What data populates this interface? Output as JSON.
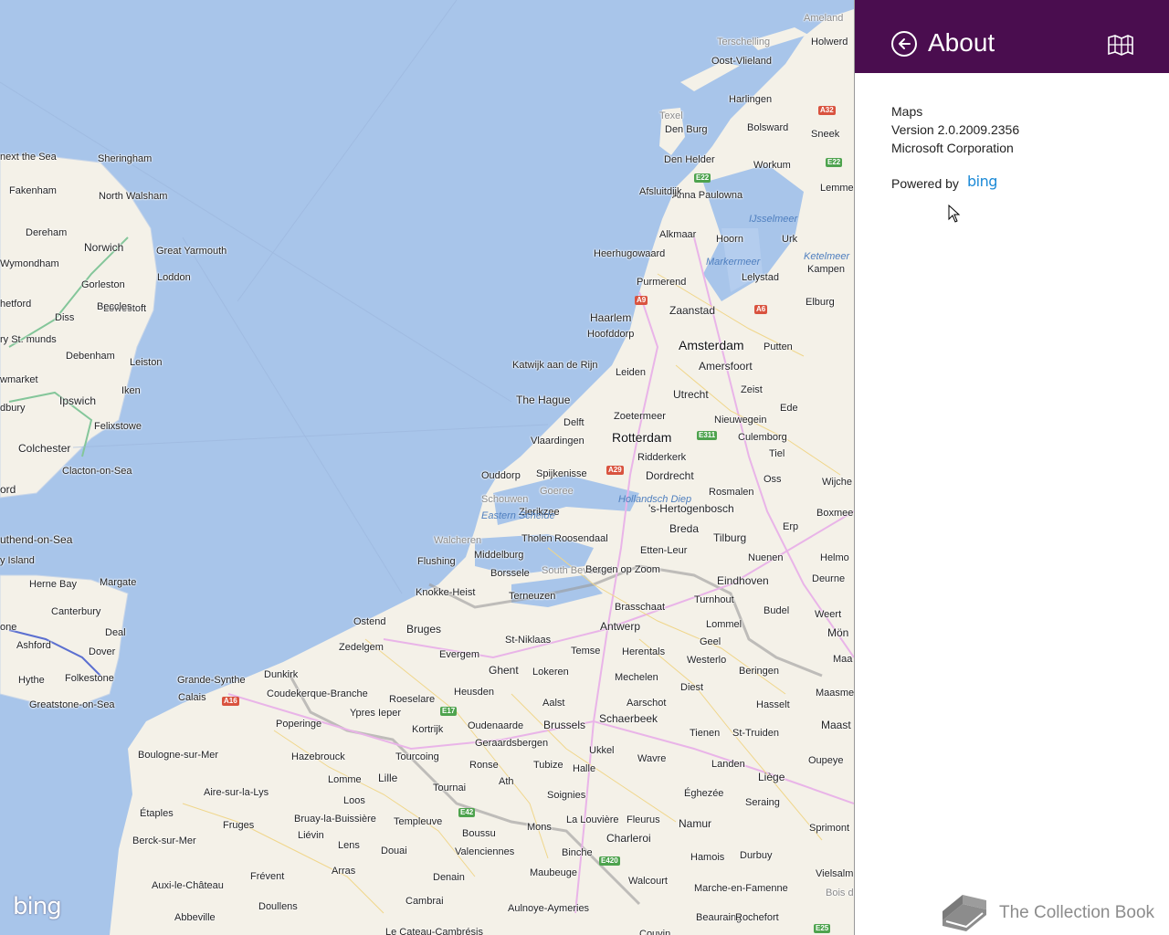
{
  "about_pane": {
    "title": "About",
    "app_name": "Maps",
    "version": "Version 2.0.2009.2356",
    "publisher": "Microsoft Corporation",
    "powered_by_label": "Powered by",
    "provider_logo_text": "bing",
    "header_color": "#4a0d4f",
    "back_icon": "back-arrow-circle-icon",
    "app_icon": "maps-tile-icon"
  },
  "map": {
    "watermark_text": "bing",
    "water_color": "#a8c5ea",
    "land_color": "#f4f1e8",
    "labels": [
      {
        "text": "Ameland",
        "cls": "faint"
      },
      {
        "text": "Terschelling",
        "cls": "faint"
      },
      {
        "text": "Holwerd",
        "cls": ""
      },
      {
        "text": "Oost-Vlieland",
        "cls": ""
      },
      {
        "text": "Harlingen",
        "cls": ""
      },
      {
        "text": "Texel",
        "cls": "faint"
      },
      {
        "text": "Den Burg",
        "cls": ""
      },
      {
        "text": "Bolsward",
        "cls": ""
      },
      {
        "text": "Sneek",
        "cls": ""
      },
      {
        "text": "Den Helder",
        "cls": ""
      },
      {
        "text": "Workum",
        "cls": ""
      },
      {
        "text": "Anna Paulowna",
        "cls": ""
      },
      {
        "text": "Lemme",
        "cls": ""
      },
      {
        "text": "Afsluitdijk",
        "cls": ""
      },
      {
        "text": "IJsselmeer",
        "cls": "water"
      },
      {
        "text": "Alkmaar",
        "cls": ""
      },
      {
        "text": "Hoorn",
        "cls": ""
      },
      {
        "text": "Urk",
        "cls": ""
      },
      {
        "text": "Ketelmeer",
        "cls": "water"
      },
      {
        "text": "Heerhugowaard",
        "cls": ""
      },
      {
        "text": "Markermeer",
        "cls": "water"
      },
      {
        "text": "Kampen",
        "cls": ""
      },
      {
        "text": "Lelystad",
        "cls": ""
      },
      {
        "text": "Purmerend",
        "cls": ""
      },
      {
        "text": "Elburg",
        "cls": ""
      },
      {
        "text": "Zaanstad",
        "cls": "mid"
      },
      {
        "text": "Haarlem",
        "cls": "mid"
      },
      {
        "text": "Hoofddorp",
        "cls": ""
      },
      {
        "text": "Amsterdam",
        "cls": "big"
      },
      {
        "text": "Putten",
        "cls": ""
      },
      {
        "text": "Katwijk aan de Rijn",
        "cls": ""
      },
      {
        "text": "Leiden",
        "cls": ""
      },
      {
        "text": "Amersfoort",
        "cls": "mid"
      },
      {
        "text": "The Hague",
        "cls": "mid"
      },
      {
        "text": "Utrecht",
        "cls": "mid"
      },
      {
        "text": "Zeist",
        "cls": ""
      },
      {
        "text": "Ede",
        "cls": ""
      },
      {
        "text": "Zoetermeer",
        "cls": ""
      },
      {
        "text": "Delft",
        "cls": ""
      },
      {
        "text": "Nieuwegein",
        "cls": ""
      },
      {
        "text": "Vlaardingen",
        "cls": ""
      },
      {
        "text": "Rotterdam",
        "cls": "big"
      },
      {
        "text": "Culemborg",
        "cls": ""
      },
      {
        "text": "Ridderkerk",
        "cls": ""
      },
      {
        "text": "Tiel",
        "cls": ""
      },
      {
        "text": "Ouddorp",
        "cls": ""
      },
      {
        "text": "Spijkenisse",
        "cls": ""
      },
      {
        "text": "Dordrecht",
        "cls": "mid"
      },
      {
        "text": "Oss",
        "cls": ""
      },
      {
        "text": "Wijche",
        "cls": ""
      },
      {
        "text": "Goeree",
        "cls": "faint"
      },
      {
        "text": "Schouwen",
        "cls": "faint"
      },
      {
        "text": "Hollandsch Diep",
        "cls": "water"
      },
      {
        "text": "Rosmalen",
        "cls": ""
      },
      {
        "text": "Zierikzee",
        "cls": ""
      },
      {
        "text": "'s-Hertogenbosch",
        "cls": "mid"
      },
      {
        "text": "Boxmee",
        "cls": ""
      },
      {
        "text": "Eastern Schelde",
        "cls": "water"
      },
      {
        "text": "Breda",
        "cls": "mid"
      },
      {
        "text": "Erp",
        "cls": ""
      },
      {
        "text": "Tholen",
        "cls": ""
      },
      {
        "text": "Roosendaal",
        "cls": ""
      },
      {
        "text": "Tilburg",
        "cls": "mid"
      },
      {
        "text": "Walcheren",
        "cls": "faint"
      },
      {
        "text": "Etten-Leur",
        "cls": ""
      },
      {
        "text": "Middelburg",
        "cls": ""
      },
      {
        "text": "Nuenen",
        "cls": ""
      },
      {
        "text": "Helmo",
        "cls": ""
      },
      {
        "text": "Flushing",
        "cls": ""
      },
      {
        "text": "South Beveland",
        "cls": "faint"
      },
      {
        "text": "Borssele",
        "cls": ""
      },
      {
        "text": "Bergen op Zoom",
        "cls": ""
      },
      {
        "text": "Eindhoven",
        "cls": "mid"
      },
      {
        "text": "Deurne",
        "cls": ""
      },
      {
        "text": "Knokke-Heist",
        "cls": ""
      },
      {
        "text": "Terneuzen",
        "cls": ""
      },
      {
        "text": "Brasschaat",
        "cls": ""
      },
      {
        "text": "Turnhout",
        "cls": ""
      },
      {
        "text": "Budel",
        "cls": ""
      },
      {
        "text": "Weert",
        "cls": ""
      },
      {
        "text": "Ostend",
        "cls": ""
      },
      {
        "text": "Bruges",
        "cls": "mid"
      },
      {
        "text": "Antwerp",
        "cls": "mid"
      },
      {
        "text": "Lommel",
        "cls": ""
      },
      {
        "text": "Mön",
        "cls": "mid"
      },
      {
        "text": "St-Niklaas",
        "cls": ""
      },
      {
        "text": "Geel",
        "cls": ""
      },
      {
        "text": "Zedelgem",
        "cls": ""
      },
      {
        "text": "Temse",
        "cls": ""
      },
      {
        "text": "Evergem",
        "cls": ""
      },
      {
        "text": "Herentals",
        "cls": ""
      },
      {
        "text": "Westerlo",
        "cls": ""
      },
      {
        "text": "Maa",
        "cls": ""
      },
      {
        "text": "Ghent",
        "cls": "mid"
      },
      {
        "text": "Lokeren",
        "cls": ""
      },
      {
        "text": "Beringen",
        "cls": ""
      },
      {
        "text": "Dunkirk",
        "cls": ""
      },
      {
        "text": "Mechelen",
        "cls": ""
      },
      {
        "text": "Grande-Synthe",
        "cls": ""
      },
      {
        "text": "Maasme",
        "cls": ""
      },
      {
        "text": "Diest",
        "cls": ""
      },
      {
        "text": "Coudekerque-Branche",
        "cls": ""
      },
      {
        "text": "Heusden",
        "cls": ""
      },
      {
        "text": "Roeselare",
        "cls": ""
      },
      {
        "text": "Calais",
        "cls": ""
      },
      {
        "text": "Aalst",
        "cls": ""
      },
      {
        "text": "Aarschot",
        "cls": ""
      },
      {
        "text": "Hasselt",
        "cls": ""
      },
      {
        "text": "Ypres Ieper",
        "cls": ""
      },
      {
        "text": "Schaerbeek",
        "cls": "mid"
      },
      {
        "text": "Poperinge",
        "cls": ""
      },
      {
        "text": "Oudenaarde",
        "cls": ""
      },
      {
        "text": "Brussels",
        "cls": "mid"
      },
      {
        "text": "Maast",
        "cls": "mid"
      },
      {
        "text": "Kortrijk",
        "cls": ""
      },
      {
        "text": "Tienen",
        "cls": ""
      },
      {
        "text": "St-Truiden",
        "cls": ""
      },
      {
        "text": "Geraardsbergen",
        "cls": ""
      },
      {
        "text": "Boulogne-sur-Mer",
        "cls": ""
      },
      {
        "text": "Hazebrouck",
        "cls": ""
      },
      {
        "text": "Tourcoing",
        "cls": ""
      },
      {
        "text": "Ukkel",
        "cls": ""
      },
      {
        "text": "Wavre",
        "cls": ""
      },
      {
        "text": "Landen",
        "cls": ""
      },
      {
        "text": "Oupeye",
        "cls": ""
      },
      {
        "text": "Ronse",
        "cls": ""
      },
      {
        "text": "Tubize",
        "cls": ""
      },
      {
        "text": "Halle",
        "cls": ""
      },
      {
        "text": "Lomme",
        "cls": ""
      },
      {
        "text": "Lille",
        "cls": "mid"
      },
      {
        "text": "Ath",
        "cls": ""
      },
      {
        "text": "Liège",
        "cls": "mid"
      },
      {
        "text": "Tournai",
        "cls": ""
      },
      {
        "text": "Aire-sur-la-Lys",
        "cls": ""
      },
      {
        "text": "Soignies",
        "cls": ""
      },
      {
        "text": "Éghezée",
        "cls": ""
      },
      {
        "text": "Loos",
        "cls": ""
      },
      {
        "text": "Seraing",
        "cls": ""
      },
      {
        "text": "Étaples",
        "cls": ""
      },
      {
        "text": "Bruay-la-Buissière",
        "cls": ""
      },
      {
        "text": "Templeuve",
        "cls": ""
      },
      {
        "text": "La Louvière",
        "cls": ""
      },
      {
        "text": "Fleurus",
        "cls": ""
      },
      {
        "text": "Namur",
        "cls": "mid"
      },
      {
        "text": "Fruges",
        "cls": ""
      },
      {
        "text": "Boussu",
        "cls": ""
      },
      {
        "text": "Mons",
        "cls": ""
      },
      {
        "text": "Sprimont",
        "cls": ""
      },
      {
        "text": "Liévin",
        "cls": ""
      },
      {
        "text": "Charleroi",
        "cls": "mid"
      },
      {
        "text": "Berck-sur-Mer",
        "cls": ""
      },
      {
        "text": "Lens",
        "cls": ""
      },
      {
        "text": "Douai",
        "cls": ""
      },
      {
        "text": "Valenciennes",
        "cls": ""
      },
      {
        "text": "Binche",
        "cls": ""
      },
      {
        "text": "Hamois",
        "cls": ""
      },
      {
        "text": "Durbuy",
        "cls": ""
      },
      {
        "text": "Arras",
        "cls": ""
      },
      {
        "text": "Maubeuge",
        "cls": ""
      },
      {
        "text": "Vielsalm",
        "cls": ""
      },
      {
        "text": "Frévent",
        "cls": ""
      },
      {
        "text": "Denain",
        "cls": ""
      },
      {
        "text": "Walcourt",
        "cls": ""
      },
      {
        "text": "Auxi-le-Château",
        "cls": ""
      },
      {
        "text": "Marche-en-Famenne",
        "cls": ""
      },
      {
        "text": "Bois de Ronce",
        "cls": "faint"
      },
      {
        "text": "Doullens",
        "cls": ""
      },
      {
        "text": "Cambrai",
        "cls": ""
      },
      {
        "text": "Aulnoye-Aymeries",
        "cls": ""
      },
      {
        "text": "Abbeville",
        "cls": ""
      },
      {
        "text": "Beauraing",
        "cls": ""
      },
      {
        "text": "Rochefort",
        "cls": ""
      },
      {
        "text": "Le Cateau-Cambrésis",
        "cls": ""
      },
      {
        "text": "Couvin",
        "cls": ""
      },
      {
        "text": "Sheringham",
        "cls": ""
      },
      {
        "text": "next the Sea",
        "cls": ""
      },
      {
        "text": "Fakenham",
        "cls": ""
      },
      {
        "text": "North Walsham",
        "cls": ""
      },
      {
        "text": "Dereham",
        "cls": ""
      },
      {
        "text": "Norwich",
        "cls": "mid"
      },
      {
        "text": "Great Yarmouth",
        "cls": ""
      },
      {
        "text": "Wymondham",
        "cls": ""
      },
      {
        "text": "Gorleston",
        "cls": ""
      },
      {
        "text": "Loddon",
        "cls": ""
      },
      {
        "text": "Lowestoft",
        "cls": ""
      },
      {
        "text": "hetford",
        "cls": ""
      },
      {
        "text": "Beccles",
        "cls": ""
      },
      {
        "text": "Diss",
        "cls": ""
      },
      {
        "text": "ry St. munds",
        "cls": ""
      },
      {
        "text": "Debenham",
        "cls": ""
      },
      {
        "text": "Leiston",
        "cls": ""
      },
      {
        "text": "wmarket",
        "cls": ""
      },
      {
        "text": "Iken",
        "cls": ""
      },
      {
        "text": "Ipswich",
        "cls": "mid"
      },
      {
        "text": "dbury",
        "cls": ""
      },
      {
        "text": "Felixstowe",
        "cls": ""
      },
      {
        "text": "Colchester",
        "cls": "mid"
      },
      {
        "text": "Clacton-on-Sea",
        "cls": ""
      },
      {
        "text": "ord",
        "cls": "mid"
      },
      {
        "text": "uthend-on-Sea",
        "cls": "mid"
      },
      {
        "text": "y Island",
        "cls": ""
      },
      {
        "text": "Herne Bay",
        "cls": ""
      },
      {
        "text": "Margate",
        "cls": ""
      },
      {
        "text": "Canterbury",
        "cls": ""
      },
      {
        "text": "Deal",
        "cls": ""
      },
      {
        "text": "one",
        "cls": ""
      },
      {
        "text": "Ashford",
        "cls": ""
      },
      {
        "text": "Dover",
        "cls": ""
      },
      {
        "text": "Hythe",
        "cls": ""
      },
      {
        "text": "Folkestone",
        "cls": ""
      },
      {
        "text": "Greatstone-on-Sea",
        "cls": ""
      }
    ],
    "shields": [
      {
        "text": "A32",
        "color": "red"
      },
      {
        "text": "E22",
        "color": "green"
      },
      {
        "text": "E22",
        "color": "green"
      },
      {
        "text": "A9",
        "color": "red"
      },
      {
        "text": "A6",
        "color": "red"
      },
      {
        "text": "E311",
        "color": "green"
      },
      {
        "text": "A29",
        "color": "red"
      },
      {
        "text": "A16",
        "color": "red"
      },
      {
        "text": "E17",
        "color": "green"
      },
      {
        "text": "E42",
        "color": "green"
      },
      {
        "text": "E420",
        "color": "green"
      },
      {
        "text": "E25",
        "color": "green"
      }
    ]
  },
  "watermark": {
    "text": "The Collection Book",
    "icon": "book-icon"
  }
}
